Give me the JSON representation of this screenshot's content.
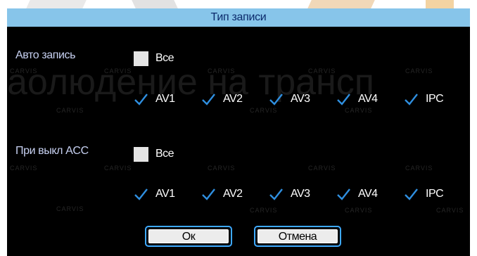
{
  "dialog": {
    "title": "Тип записи"
  },
  "watermark": {
    "phrase": "аолюдение на трансп",
    "logo": "CARVIS"
  },
  "auto_record": {
    "label": "Авто запись",
    "all_label": "Все",
    "all_checked": false,
    "channels": [
      {
        "label": "AV1",
        "checked": true
      },
      {
        "label": "AV2",
        "checked": true
      },
      {
        "label": "AV3",
        "checked": true
      },
      {
        "label": "AV4",
        "checked": true
      },
      {
        "label": "IPC",
        "checked": true
      }
    ]
  },
  "acc_off": {
    "label": "При выкл ACC",
    "all_label": "Все",
    "all_checked": false,
    "channels": [
      {
        "label": "AV1",
        "checked": true
      },
      {
        "label": "AV2",
        "checked": true
      },
      {
        "label": "AV3",
        "checked": true
      },
      {
        "label": "AV4",
        "checked": true
      },
      {
        "label": "IPC",
        "checked": true
      }
    ]
  },
  "buttons": {
    "ok": "Ок",
    "cancel": "Отмена"
  },
  "colors": {
    "title_bar": "#87c5ea",
    "check_color": "#2f8fe0",
    "button_border": "#3ea9ff"
  }
}
